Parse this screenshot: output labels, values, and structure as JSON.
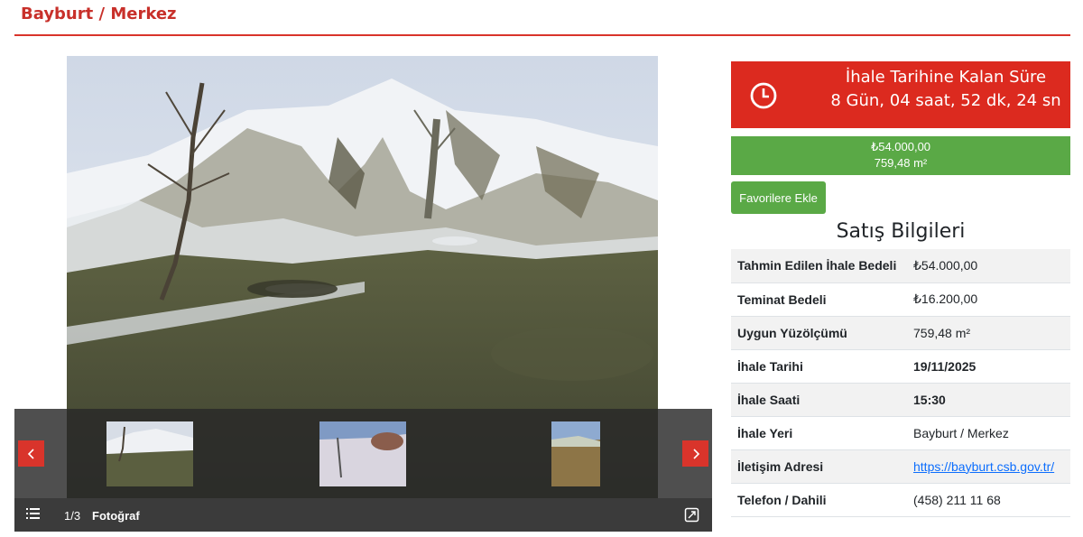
{
  "header": {
    "location_title": "Bayburt / Merkez"
  },
  "gallery": {
    "counter": "1/3",
    "label": "Fotoğraf",
    "prev_icon": "chevron-left-icon",
    "next_icon": "chevron-right-icon",
    "list_icon": "list-icon",
    "expand_icon": "expand-icon"
  },
  "countdown": {
    "title": "İhale Tarihine Kalan Süre",
    "time": "8 Gün, 04 saat, 52 dk, 24 sn",
    "icon": "clock-icon"
  },
  "price": {
    "amount": "₺54.000,00",
    "area": "759,48 m²"
  },
  "favorite_button": "Favorilere Ekle",
  "sales_info": {
    "title": "Satış Bilgileri",
    "rows": [
      {
        "key": "Tahmin Edilen İhale Bedeli",
        "value": "₺54.000,00"
      },
      {
        "key": "Teminat Bedeli",
        "value": "₺16.200,00"
      },
      {
        "key": "Uygun Yüzölçümü",
        "value": "759,48 m²"
      },
      {
        "key": "İhale Tarihi",
        "value": "19/11/2025"
      },
      {
        "key": "İhale Saati",
        "value": "15:30"
      },
      {
        "key": "İhale Yeri",
        "value": "Bayburt / Merkez"
      },
      {
        "key": "İletişim Adresi",
        "value": "https://bayburt.csb.gov.tr/"
      },
      {
        "key": "Telefon / Dahili",
        "value": "(458) 211 11 68"
      }
    ]
  },
  "colors": {
    "accent_red": "#d9342b",
    "countdown_red": "#dc2a1f",
    "success_green": "#5aa946",
    "link_blue": "#0d6efd"
  }
}
